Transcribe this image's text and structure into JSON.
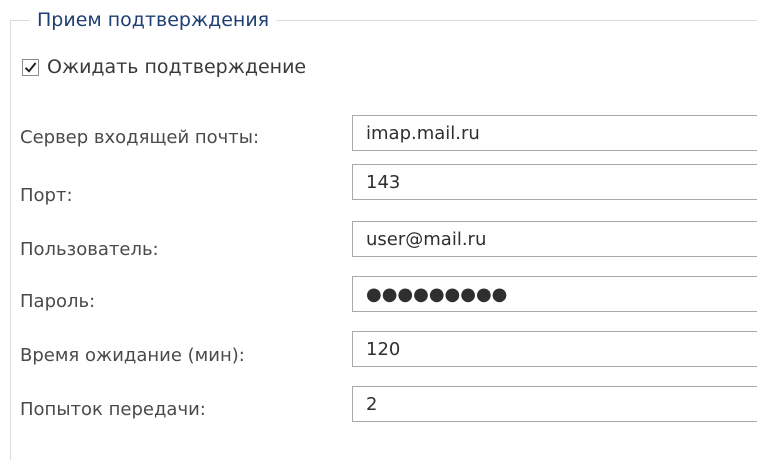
{
  "group": {
    "title": "Прием подтверждения"
  },
  "wait_confirmation": {
    "label": "Ожидать подтверждение",
    "checked": true
  },
  "fields": {
    "server": {
      "label": "Сервер входящей почты:",
      "value": "imap.mail.ru"
    },
    "port": {
      "label": "Порт:",
      "value": "143"
    },
    "user": {
      "label": "Пользователь:",
      "value": "user@mail.ru"
    },
    "password": {
      "label": "Пароль:",
      "value": "●●●●●●●●●"
    },
    "timeout": {
      "label": "Время ожидание (мин):",
      "value": "120"
    },
    "attempts": {
      "label": "Попыток передачи:",
      "value": "2"
    }
  }
}
